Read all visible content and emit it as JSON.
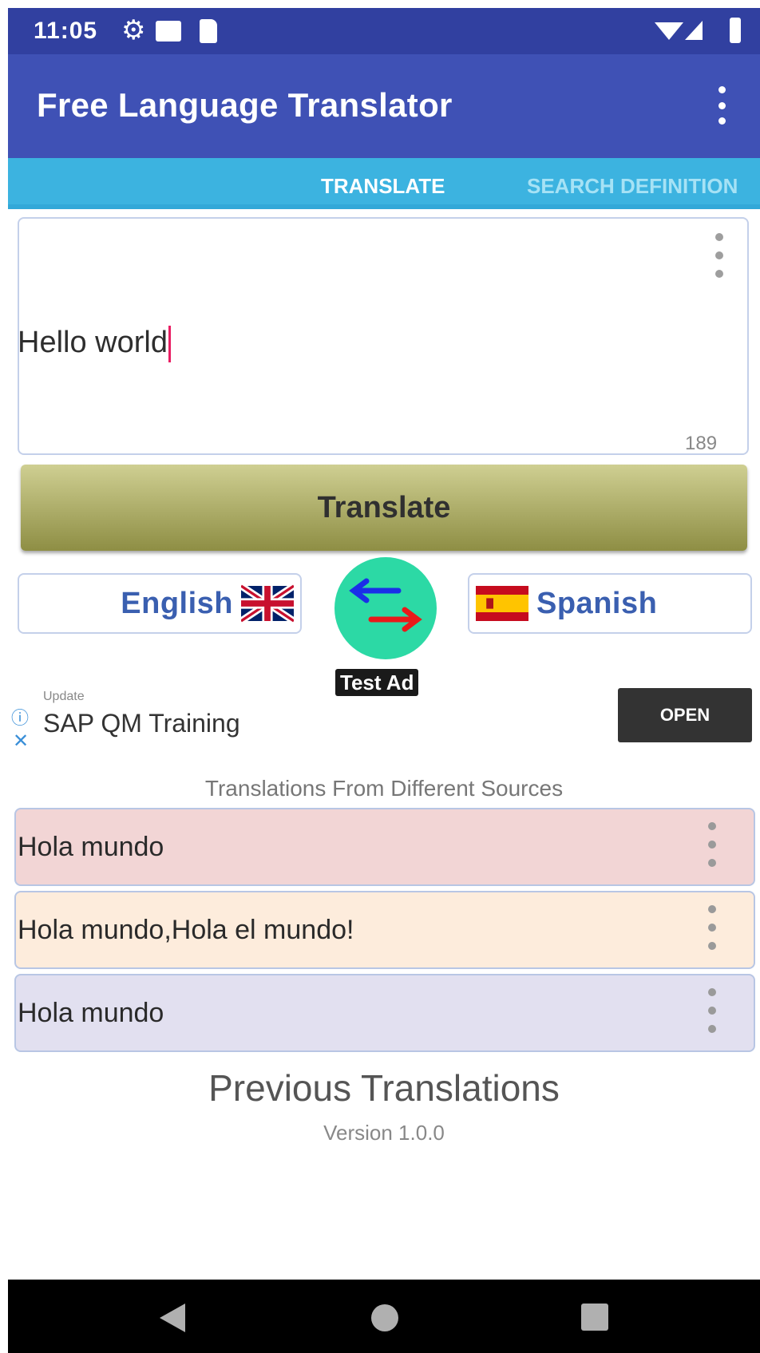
{
  "status_bar": {
    "time": "11:05"
  },
  "app_bar": {
    "title": "Free Language Translator"
  },
  "tabs": [
    {
      "label": "TRANSLATE"
    },
    {
      "label": "SEARCH DEFINITION"
    }
  ],
  "input": {
    "text": "Hello world",
    "char_count": "189"
  },
  "translate_button": {
    "label": "Translate"
  },
  "languages": {
    "source": {
      "name": "English",
      "flag": "uk-flag"
    },
    "target": {
      "name": "Spanish",
      "flag": "spain-flag"
    }
  },
  "ad": {
    "badge": "Test Ad",
    "small_text": "Update",
    "title": "SAP QM Training",
    "button": "OPEN"
  },
  "results": {
    "header": "Translations From Different Sources",
    "items": [
      {
        "text": "Hola mundo",
        "color": "#f2d5d5"
      },
      {
        "text": "Hola mundo,Hola el mundo!",
        "color": "#fdecdc"
      },
      {
        "text": "Hola mundo",
        "color": "#e2e0f0"
      }
    ]
  },
  "footer": {
    "previous_title": "Previous Translations",
    "version": "Version 1.0.0"
  },
  "colors": {
    "status_bar": "#3140a0",
    "app_bar": "#3f51b5",
    "tab_bar": "#3cb3e0",
    "swap_button": "#2cd9a5"
  }
}
